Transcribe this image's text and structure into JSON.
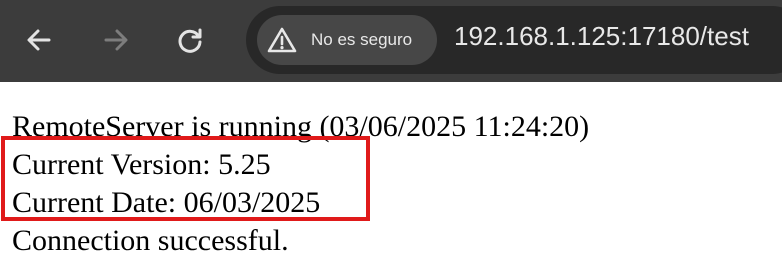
{
  "browser": {
    "security_label": "No es seguro",
    "url": "192.168.1.125:17180/test",
    "icons": {
      "back": "arrow-left-icon",
      "forward": "arrow-right-icon",
      "reload": "reload-icon",
      "security": "warning-triangle-icon"
    },
    "colors": {
      "toolbar": "#3c3c3c",
      "omnibox": "#282828",
      "chip": "#474747",
      "highlight": "#e01a1a"
    }
  },
  "page": {
    "lines": [
      "RemoteServer is running (03/06/2025 11:24:20)",
      "Current Version: 5.25",
      "Current Date: 06/03/2025",
      "Connection successful."
    ]
  }
}
